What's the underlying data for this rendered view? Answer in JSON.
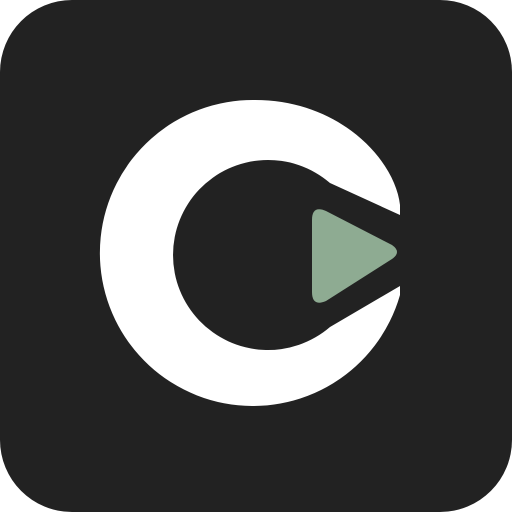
{
  "icon": {
    "name": "play-logo-app-icon",
    "colors": {
      "background": "#222222",
      "ring": "#ffffff",
      "play": "#8eab92"
    },
    "icons": [
      "ring-c-icon",
      "play-triangle-icon"
    ]
  }
}
